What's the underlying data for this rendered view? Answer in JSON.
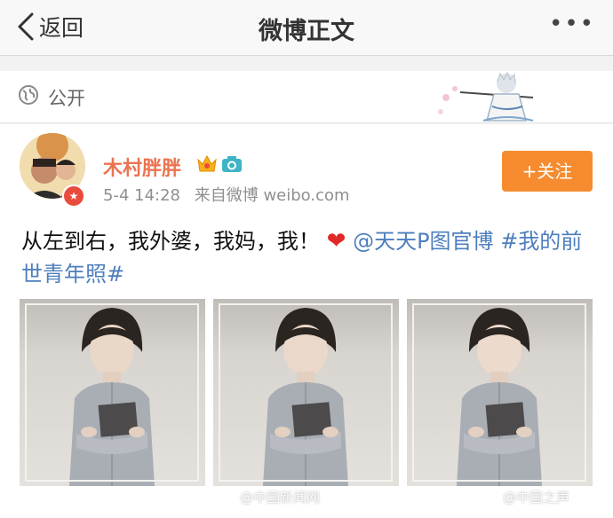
{
  "nav": {
    "back_label": "返回",
    "title": "微博正文"
  },
  "visibility": {
    "label": "公开"
  },
  "post": {
    "username": "木村胖胖",
    "time": "5-4 14:28",
    "source": "来自微博 weibo.com",
    "follow_label": "+关注",
    "text_main": "从左到右，我外婆，我妈，我！",
    "heart": "❤",
    "mention": "@天天P图官博",
    "topic": "#我的前世青年照#"
  },
  "watermarks": [
    "@中国新闻网",
    "@中国之声"
  ],
  "colors": {
    "accent": "#eb7350",
    "link": "#4d7ebd",
    "follow_button": "#f68c2f"
  }
}
